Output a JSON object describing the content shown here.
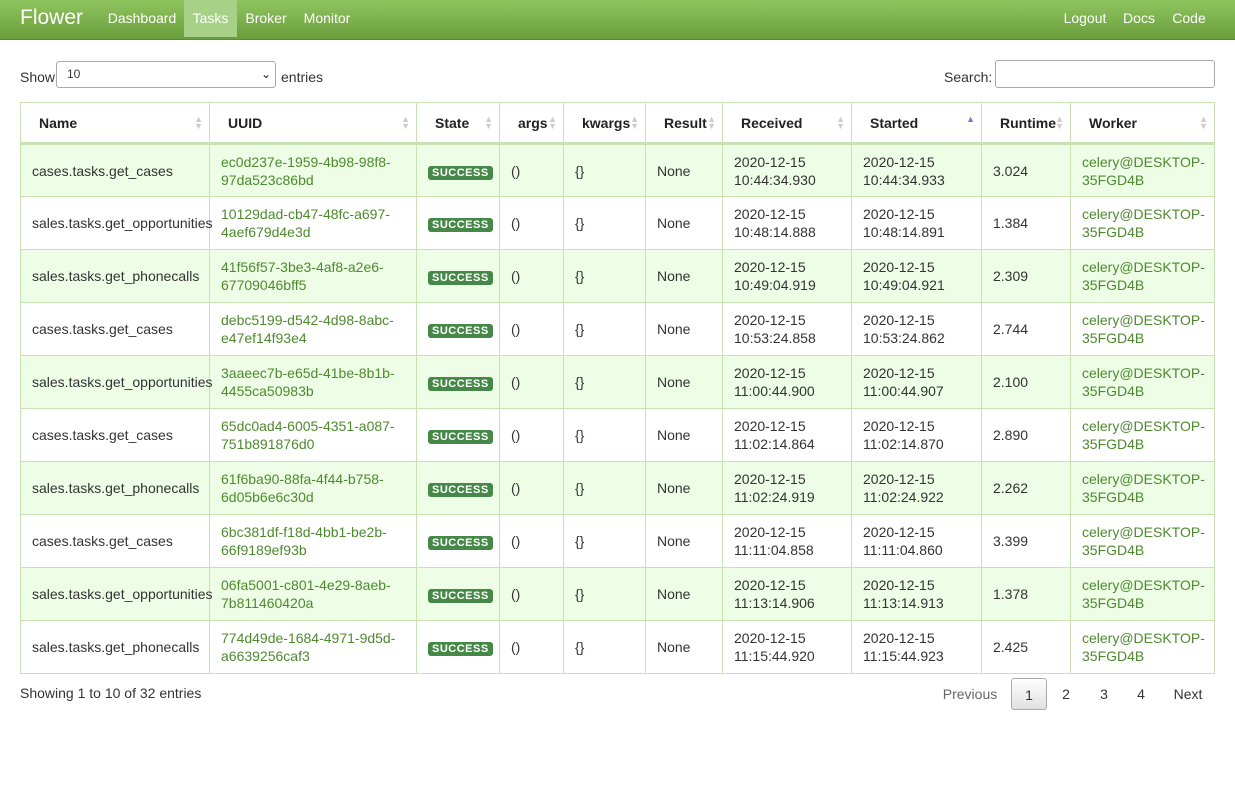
{
  "nav": {
    "brand": "Flower",
    "items": [
      {
        "label": "Dashboard"
      },
      {
        "label": "Tasks"
      },
      {
        "label": "Broker"
      },
      {
        "label": "Monitor"
      }
    ],
    "right": [
      {
        "label": "Logout"
      },
      {
        "label": "Docs"
      },
      {
        "label": "Code"
      }
    ]
  },
  "controls": {
    "show_label": "Show",
    "show_value": "10",
    "entries_label": "entries",
    "search_label": "Search:",
    "search_value": ""
  },
  "table": {
    "headers": [
      "Name",
      "UUID",
      "State",
      "args",
      "kwargs",
      "Result",
      "Received",
      "Started",
      "Runtime",
      "Worker"
    ],
    "rows": [
      {
        "name": "cases.tasks.get_cases",
        "uuid1": "ec0d237e-1959-4b98-98f8-",
        "uuid2": "97da523c86bd",
        "state": "SUCCESS",
        "args": "()",
        "kwargs": "{}",
        "result": "None",
        "rec1": "2020-12-15",
        "rec2": "10:44:34.930",
        "st1": "2020-12-15",
        "st2": "10:44:34.933",
        "runtime": "3.024",
        "w1": "celery@DESKTOP-",
        "w2": "35FGD4B"
      },
      {
        "name": "sales.tasks.get_opportunities",
        "uuid1": "10129dad-cb47-48fc-a697-",
        "uuid2": "4aef679d4e3d",
        "state": "SUCCESS",
        "args": "()",
        "kwargs": "{}",
        "result": "None",
        "rec1": "2020-12-15",
        "rec2": "10:48:14.888",
        "st1": "2020-12-15",
        "st2": "10:48:14.891",
        "runtime": "1.384",
        "w1": "celery@DESKTOP-",
        "w2": "35FGD4B"
      },
      {
        "name": "sales.tasks.get_phonecalls",
        "uuid1": "41f56f57-3be3-4af8-a2e6-",
        "uuid2": "67709046bff5",
        "state": "SUCCESS",
        "args": "()",
        "kwargs": "{}",
        "result": "None",
        "rec1": "2020-12-15",
        "rec2": "10:49:04.919",
        "st1": "2020-12-15",
        "st2": "10:49:04.921",
        "runtime": "2.309",
        "w1": "celery@DESKTOP-",
        "w2": "35FGD4B"
      },
      {
        "name": "cases.tasks.get_cases",
        "uuid1": "debc5199-d542-4d98-8abc-",
        "uuid2": "e47ef14f93e4",
        "state": "SUCCESS",
        "args": "()",
        "kwargs": "{}",
        "result": "None",
        "rec1": "2020-12-15",
        "rec2": "10:53:24.858",
        "st1": "2020-12-15",
        "st2": "10:53:24.862",
        "runtime": "2.744",
        "w1": "celery@DESKTOP-",
        "w2": "35FGD4B"
      },
      {
        "name": "sales.tasks.get_opportunities",
        "uuid1": "3aaeec7b-e65d-41be-8b1b-",
        "uuid2": "4455ca50983b",
        "state": "SUCCESS",
        "args": "()",
        "kwargs": "{}",
        "result": "None",
        "rec1": "2020-12-15",
        "rec2": "11:00:44.900",
        "st1": "2020-12-15",
        "st2": "11:00:44.907",
        "runtime": "2.100",
        "w1": "celery@DESKTOP-",
        "w2": "35FGD4B"
      },
      {
        "name": "cases.tasks.get_cases",
        "uuid1": "65dc0ad4-6005-4351-a087-",
        "uuid2": "751b891876d0",
        "state": "SUCCESS",
        "args": "()",
        "kwargs": "{}",
        "result": "None",
        "rec1": "2020-12-15",
        "rec2": "11:02:14.864",
        "st1": "2020-12-15",
        "st2": "11:02:14.870",
        "runtime": "2.890",
        "w1": "celery@DESKTOP-",
        "w2": "35FGD4B"
      },
      {
        "name": "sales.tasks.get_phonecalls",
        "uuid1": "61f6ba90-88fa-4f44-b758-",
        "uuid2": "6d05b6e6c30d",
        "state": "SUCCESS",
        "args": "()",
        "kwargs": "{}",
        "result": "None",
        "rec1": "2020-12-15",
        "rec2": "11:02:24.919",
        "st1": "2020-12-15",
        "st2": "11:02:24.922",
        "runtime": "2.262",
        "w1": "celery@DESKTOP-",
        "w2": "35FGD4B"
      },
      {
        "name": "cases.tasks.get_cases",
        "uuid1": "6bc381df-f18d-4bb1-be2b-",
        "uuid2": "66f9189ef93b",
        "state": "SUCCESS",
        "args": "()",
        "kwargs": "{}",
        "result": "None",
        "rec1": "2020-12-15",
        "rec2": "11:11:04.858",
        "st1": "2020-12-15",
        "st2": "11:11:04.860",
        "runtime": "3.399",
        "w1": "celery@DESKTOP-",
        "w2": "35FGD4B"
      },
      {
        "name": "sales.tasks.get_opportunities",
        "uuid1": "06fa5001-c801-4e29-8aeb-",
        "uuid2": "7b811460420a",
        "state": "SUCCESS",
        "args": "()",
        "kwargs": "{}",
        "result": "None",
        "rec1": "2020-12-15",
        "rec2": "11:13:14.906",
        "st1": "2020-12-15",
        "st2": "11:13:14.913",
        "runtime": "1.378",
        "w1": "celery@DESKTOP-",
        "w2": "35FGD4B"
      },
      {
        "name": "sales.tasks.get_phonecalls",
        "uuid1": "774d49de-1684-4971-9d5d-",
        "uuid2": "a6639256caf3",
        "state": "SUCCESS",
        "args": "()",
        "kwargs": "{}",
        "result": "None",
        "rec1": "2020-12-15",
        "rec2": "11:15:44.920",
        "st1": "2020-12-15",
        "st2": "11:15:44.923",
        "runtime": "2.425",
        "w1": "celery@DESKTOP-",
        "w2": "35FGD4B"
      }
    ]
  },
  "footer": {
    "info": "Showing 1 to 10 of 32 entries",
    "previous": "Previous",
    "pages": [
      "1",
      "2",
      "3",
      "4"
    ],
    "next": "Next"
  },
  "colors": {
    "navbar": "#7cb24c",
    "active_tab": "#a6d186",
    "link": "#4d8a2e",
    "badge": "#468847",
    "row_highlight": "#eefde6"
  }
}
